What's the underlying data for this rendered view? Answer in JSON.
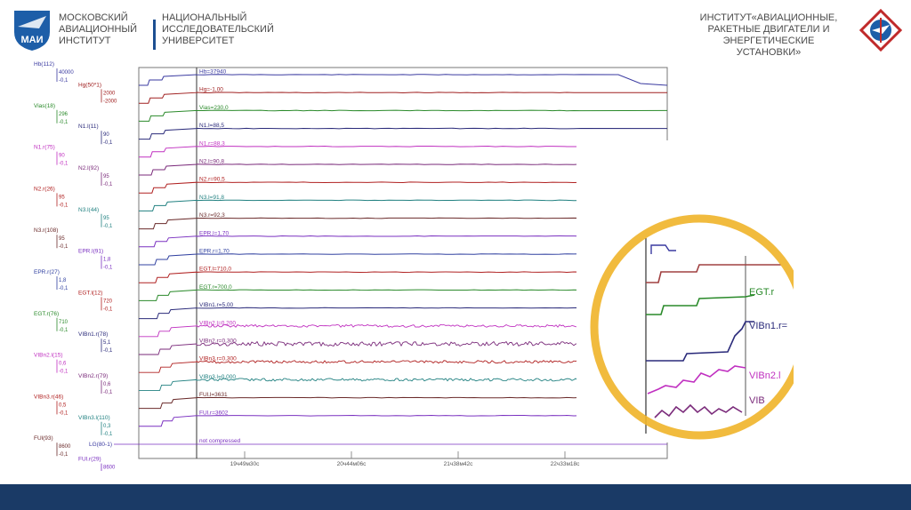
{
  "header": {
    "left_institute": "МОСКОВСКИЙ\nАВИАЦИОННЫЙ\nИНСТИТУТ",
    "left_university": "НАЦИОНАЛЬНЫЙ\nИССЛЕДОВАТЕЛЬСКИЙ\nУНИВЕРСИТЕТ",
    "right_institute": "ИНСТИТУТ«АВИАЦИОННЫЕ,\nРАКЕТНЫЕ ДВИГАТЕЛИ И\nЭНЕРГЕТИЧЕСКИЕ\nУСТАНОВКИ»",
    "logo_text": "МАИ"
  },
  "scale_labels": [
    {
      "name": "Hb(112)",
      "max": "40000",
      "min": "-0,1",
      "color": "#3a3aa0"
    },
    {
      "name": "Hg(50*1)",
      "max": "2000",
      "min": "-2000",
      "color": "#a02020"
    },
    {
      "name": "Vias(18)",
      "max": "296",
      "min": "-0,1",
      "color": "#2a8a2a"
    },
    {
      "name": "N1.l(11)",
      "max": "90",
      "min": "-0,1",
      "color": "#2a2a7a"
    },
    {
      "name": "N1.r(75)",
      "max": "90",
      "min": "-0,1",
      "color": "#c030c0"
    },
    {
      "name": "N2.l(92)",
      "max": "95",
      "min": "-0,1",
      "color": "#7a2a7a"
    },
    {
      "name": "N2.r(26)",
      "max": "95",
      "min": "-0,1",
      "color": "#b02020"
    },
    {
      "name": "N3.l(44)",
      "max": "95",
      "min": "-0,1",
      "color": "#208080"
    },
    {
      "name": "N3.r(108)",
      "max": "95",
      "min": "-0,1",
      "color": "#6a2a2a"
    },
    {
      "name": "EPR.l(91)",
      "max": "1,8",
      "min": "-0,1",
      "color": "#7a30c0"
    },
    {
      "name": "EPR.r(27)",
      "max": "1,8",
      "min": "-0,1",
      "color": "#3040a0"
    },
    {
      "name": "EGT.l(12)",
      "max": "720",
      "min": "-0,1",
      "color": "#b02020"
    },
    {
      "name": "EGT.r(76)",
      "max": "710",
      "min": "-0,1",
      "color": "#2a8a2a"
    },
    {
      "name": "VIBn1.r(78)",
      "max": "5,1",
      "min": "-0,1",
      "color": "#2a2a7a"
    },
    {
      "name": "VIBn2.l(15)",
      "max": "0,6",
      "min": "-0,1",
      "color": "#c030c0"
    },
    {
      "name": "VIBn2.r(79)",
      "max": "0,6",
      "min": "-0,1",
      "color": "#7a2a7a"
    },
    {
      "name": "VIBn3.r(46)",
      "max": "0,5",
      "min": "-0,1",
      "color": "#b02020"
    },
    {
      "name": "VIBn3.l(110)",
      "max": "0,3",
      "min": "-0,1",
      "color": "#208080"
    },
    {
      "name": "FUl(93)",
      "max": "8600",
      "min": "-0,1",
      "color": "#6a2a2a"
    },
    {
      "name": "FUl.r(29)",
      "max": "8600",
      "min": "-0,1",
      "color": "#7a30c0"
    }
  ],
  "trace_labels": [
    {
      "text": "Hb=37940",
      "color": "#3a3aa0"
    },
    {
      "text": "Hg=-1,00",
      "color": "#a02020"
    },
    {
      "text": "Vias=230,0",
      "color": "#2a8a2a"
    },
    {
      "text": "N1.l=88,5",
      "color": "#2a2a7a"
    },
    {
      "text": "N1.r=88,3",
      "color": "#c030c0"
    },
    {
      "text": "N2.l=90,8",
      "color": "#7a2a7a"
    },
    {
      "text": "N2.r=90,5",
      "color": "#b02020"
    },
    {
      "text": "N3.l=91,8",
      "color": "#208080"
    },
    {
      "text": "N3.r=92,3",
      "color": "#6a2a2a"
    },
    {
      "text": "EPR.l=1,70",
      "color": "#7a30c0"
    },
    {
      "text": "EPR.r=1,70",
      "color": "#3040a0"
    },
    {
      "text": "EGT.l=710,0",
      "color": "#b02020"
    },
    {
      "text": "EGT.r=700,0",
      "color": "#2a8a2a"
    },
    {
      "text": "VIBn1.r=5,00",
      "color": "#2a2a7a"
    },
    {
      "text": "VIBn2.l=0,200",
      "color": "#c030c0"
    },
    {
      "text": "VIBn2.r=0,300",
      "color": "#7a2a7a"
    },
    {
      "text": "VIBn3.r=0,300",
      "color": "#b02020"
    },
    {
      "text": "VIBn3.l=0,000",
      "color": "#208080"
    },
    {
      "text": "FUl.l=3631",
      "color": "#6a2a2a"
    },
    {
      "text": "FUl.r=3602",
      "color": "#7a30c0"
    }
  ],
  "bottom": {
    "lg_label": "LG(80-1)",
    "lg_value": "not compressed",
    "time_ticks": [
      "19ч49м30с",
      "20ч44м06с",
      "21ч38м42с",
      "22ч33м18с"
    ]
  },
  "zoom": {
    "labels": [
      "EGT.r",
      "VIBn1.r=",
      "VIBn2.l",
      "VIB"
    ],
    "ring_color": "#f0b429"
  }
}
